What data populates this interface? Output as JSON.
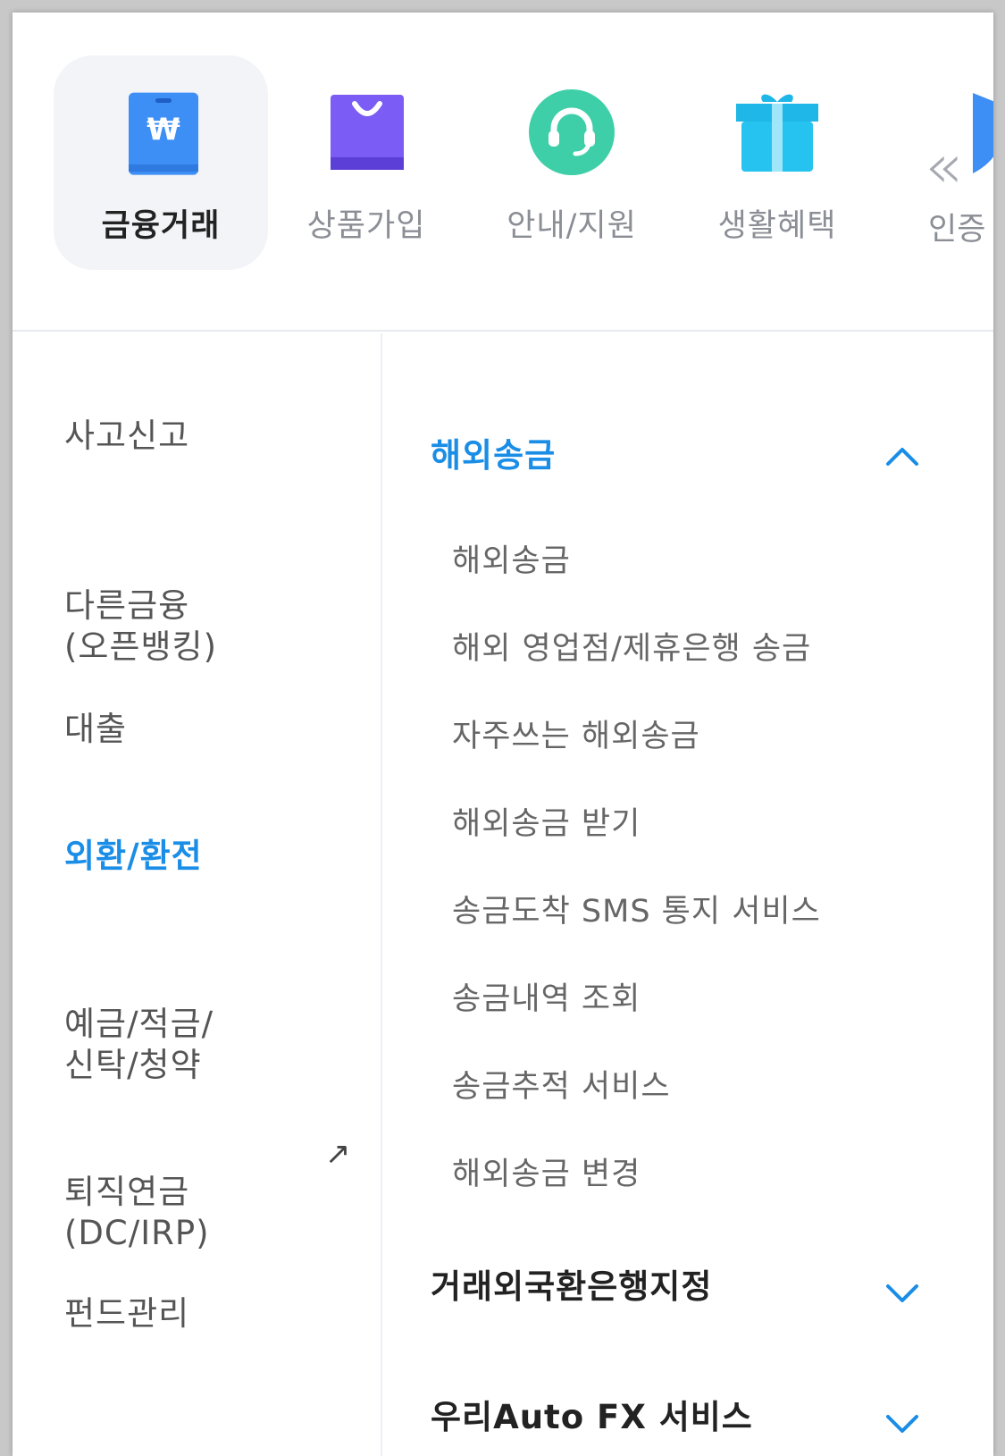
{
  "categories": [
    {
      "label": "금융거래",
      "icon": "wallet-won-icon",
      "active": true
    },
    {
      "label": "상품가입",
      "icon": "shopping-bag-icon",
      "active": false
    },
    {
      "label": "안내/지원",
      "icon": "headset-icon",
      "active": false
    },
    {
      "label": "생활혜택",
      "icon": "gift-icon",
      "active": false
    }
  ],
  "partial_category": {
    "label": "인증",
    "icon": "shield-icon"
  },
  "left_menu": [
    {
      "label": "사고신고"
    },
    {
      "label": "다른금융\n(오픈뱅킹)"
    },
    {
      "label": "대출"
    },
    {
      "label": "외환/환전",
      "active": true
    },
    {
      "label": "예금/적금/\n신탁/청약"
    },
    {
      "label": "퇴직연금\n(DC/IRP)",
      "external": true
    },
    {
      "label": "펀드관리"
    }
  ],
  "external_link_glyph": "↗",
  "sections": [
    {
      "title": "해외송금",
      "expanded": true,
      "items": [
        "해외송금",
        "해외 영업점/제휴은행 송금",
        "자주쓰는 해외송금",
        "해외송금 받기",
        "송금도착 SMS 통지 서비스",
        "송금내역 조회",
        "송금추적 서비스",
        "해외송금 변경"
      ]
    },
    {
      "title": "거래외국환은행지정",
      "expanded": false
    },
    {
      "title": "우리Auto FX 서비스",
      "expanded": false
    }
  ],
  "colors": {
    "accent": "#1a8de6",
    "active_bg": "#f2f4f8",
    "icon_wallet": "#3d8ef5",
    "icon_bag": "#7b5cf5",
    "icon_headset": "#3fcfa8",
    "icon_gift": "#1fb6e8"
  }
}
